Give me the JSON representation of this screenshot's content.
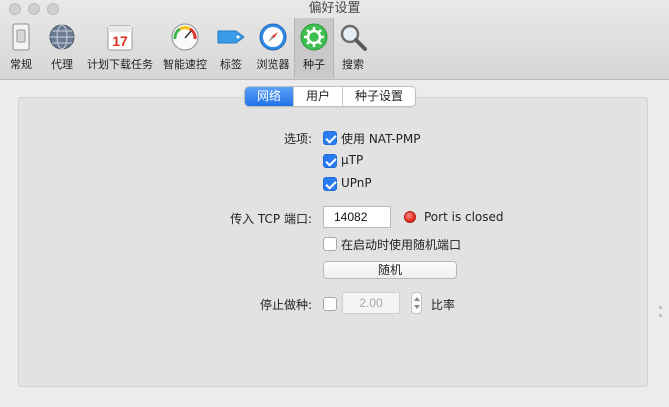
{
  "window": {
    "title": "偏好设置"
  },
  "toolbar": [
    {
      "label": "常规",
      "icon": "general-switch-icon"
    },
    {
      "label": "代理",
      "icon": "globe-icon"
    },
    {
      "label": "计划下载任务",
      "icon": "calendar-icon",
      "calendar_day": "17"
    },
    {
      "label": "智能速控",
      "icon": "speedometer-icon"
    },
    {
      "label": "标签",
      "icon": "tag-icon"
    },
    {
      "label": "浏览器",
      "icon": "compass-icon"
    },
    {
      "label": "种子",
      "icon": "gear-icon",
      "active": true
    },
    {
      "label": "搜索",
      "icon": "magnifier-icon"
    }
  ],
  "tabs": [
    {
      "label": "网络",
      "selected": true
    },
    {
      "label": "用户",
      "selected": false
    },
    {
      "label": "种子设置",
      "selected": false
    }
  ],
  "network": {
    "options_label": "选项:",
    "options": [
      {
        "label": "使用 NAT-PMP",
        "checked": true
      },
      {
        "label": "µTP",
        "checked": true
      },
      {
        "label": "UPnP",
        "checked": true
      }
    ],
    "tcp_port_label": "传入 TCP 端口:",
    "tcp_port_value": "14082",
    "port_status": "Port is closed",
    "random_on_start_label": "在启动时使用随机端口",
    "random_on_start_checked": false,
    "random_button": "随机",
    "stop_seeding_label": "停止做种:",
    "stop_seeding_checked": false,
    "ratio_value": "2.00",
    "ratio_unit": "比率"
  },
  "colors": {
    "accent": "#2a7bf0",
    "status_closed": "#e0241a"
  }
}
